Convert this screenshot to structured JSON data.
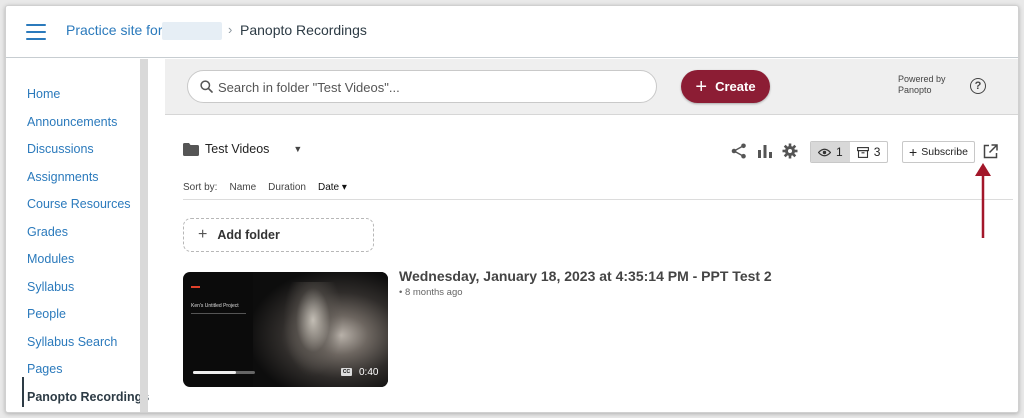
{
  "breadcrumb": {
    "site": "Practice site for",
    "separator": "›",
    "current": "Panopto Recordings"
  },
  "sidebar": {
    "items": [
      {
        "label": "Home"
      },
      {
        "label": "Announcements"
      },
      {
        "label": "Discussions"
      },
      {
        "label": "Assignments"
      },
      {
        "label": "Course Resources"
      },
      {
        "label": "Grades"
      },
      {
        "label": "Modules"
      },
      {
        "label": "Syllabus"
      },
      {
        "label": "People"
      },
      {
        "label": "Syllabus Search"
      },
      {
        "label": "Pages"
      },
      {
        "label": "Panopto Recordings",
        "active": true
      }
    ]
  },
  "panopto": {
    "search_placeholder": "Search in folder \"Test Videos\"...",
    "create_label": "Create",
    "powered_by": "Powered by Panopto",
    "help_glyph": "?",
    "folder_name": "Test Videos",
    "viewed_count": "1",
    "archived_count": "3",
    "subscribe_label": "Subscribe",
    "sort": {
      "label": "Sort by:",
      "options": [
        "Name",
        "Duration",
        "Date"
      ],
      "selected": "Date"
    },
    "add_folder_label": "Add folder",
    "videos": [
      {
        "title": "Wednesday, January 18, 2023 at 4:35:14 PM - PPT Test 2",
        "age": "• 8 months ago",
        "duration": "0:40",
        "thumb_caption": "Ken's Untitled Project",
        "cc_label": "CC",
        "progress": 0.7
      }
    ]
  },
  "colors": {
    "link_blue": "#2b7abc",
    "create_button": "#8c1d34",
    "annotation_arrow": "#a3172a"
  }
}
